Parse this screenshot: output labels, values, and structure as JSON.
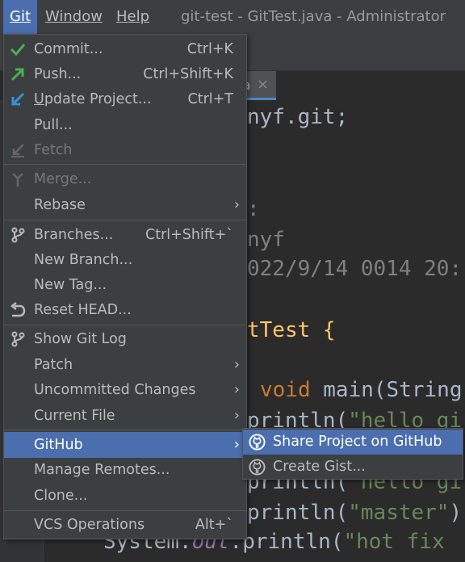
{
  "menubar": {
    "git": "Git",
    "window": "Window",
    "help": "Help",
    "title": "git-test - GitTest.java - Administrator"
  },
  "editor": {
    "tab_name": "a",
    "tab_close": "×",
    "lines": {
      "l1": "nyf.git;",
      "l2": ":",
      "l3": "nyf",
      "l4": "022/9/14 0014 20:",
      "l5_name": "tTest",
      "l5_brace": " {",
      "l6_kw": "void",
      "l6_fn": " main(",
      "l6_cls": "String",
      "l7_a": "println(",
      "l7_s": "\"hello gi",
      "l8_a": "println(",
      "l8_s": "\"hello gi",
      "l9_a": "println(",
      "l9_s": "\"master\"",
      "l9_b": ")",
      "l10_sys": "System.",
      "l10_out": "out",
      "l10_a": ".println(",
      "l10_s": "\"hot fix"
    }
  },
  "git_menu": {
    "items": [
      {
        "label": "Commit...",
        "shortcut": "Ctrl+K",
        "icon": "checkmark-icon"
      },
      {
        "label": "Push...",
        "shortcut": "Ctrl+Shift+K",
        "icon": "push-arrow-icon"
      },
      {
        "label": "Update Project...",
        "shortcut": "Ctrl+T",
        "icon": "update-arrow-icon"
      },
      {
        "label": "Pull..."
      },
      {
        "label": "Fetch",
        "icon": "fetch-icon"
      },
      {
        "label": "Merge...",
        "icon": "merge-icon"
      },
      {
        "label": "Rebase",
        "arrow": "›"
      },
      {
        "label": "Branches...",
        "shortcut": "Ctrl+Shift+`",
        "icon": "branch-icon"
      },
      {
        "label": "New Branch..."
      },
      {
        "label": "New Tag..."
      },
      {
        "label": "Reset HEAD...",
        "icon": "reset-icon"
      },
      {
        "label": "Show Git Log",
        "icon": "git-log-icon"
      },
      {
        "label": "Patch",
        "arrow": "›"
      },
      {
        "label": "Uncommitted Changes",
        "arrow": "›"
      },
      {
        "label": "Current File",
        "arrow": "›"
      },
      {
        "label": "GitHub",
        "arrow": "›"
      },
      {
        "label": "Manage Remotes..."
      },
      {
        "label": "Clone..."
      },
      {
        "label": "VCS Operations",
        "shortcut": "Alt+`"
      }
    ]
  },
  "github_submenu": {
    "items": [
      {
        "label": "Share Project on GitHub",
        "icon": "github-icon"
      },
      {
        "label": "Create Gist...",
        "icon": "github-icon"
      }
    ]
  },
  "colors": {
    "menu_bg": "#3c3f41",
    "selection": "#4b6eaf",
    "editor_bg": "#2b2b2b",
    "commit_green": "#4caf50",
    "update_blue": "#3d8fd4"
  }
}
